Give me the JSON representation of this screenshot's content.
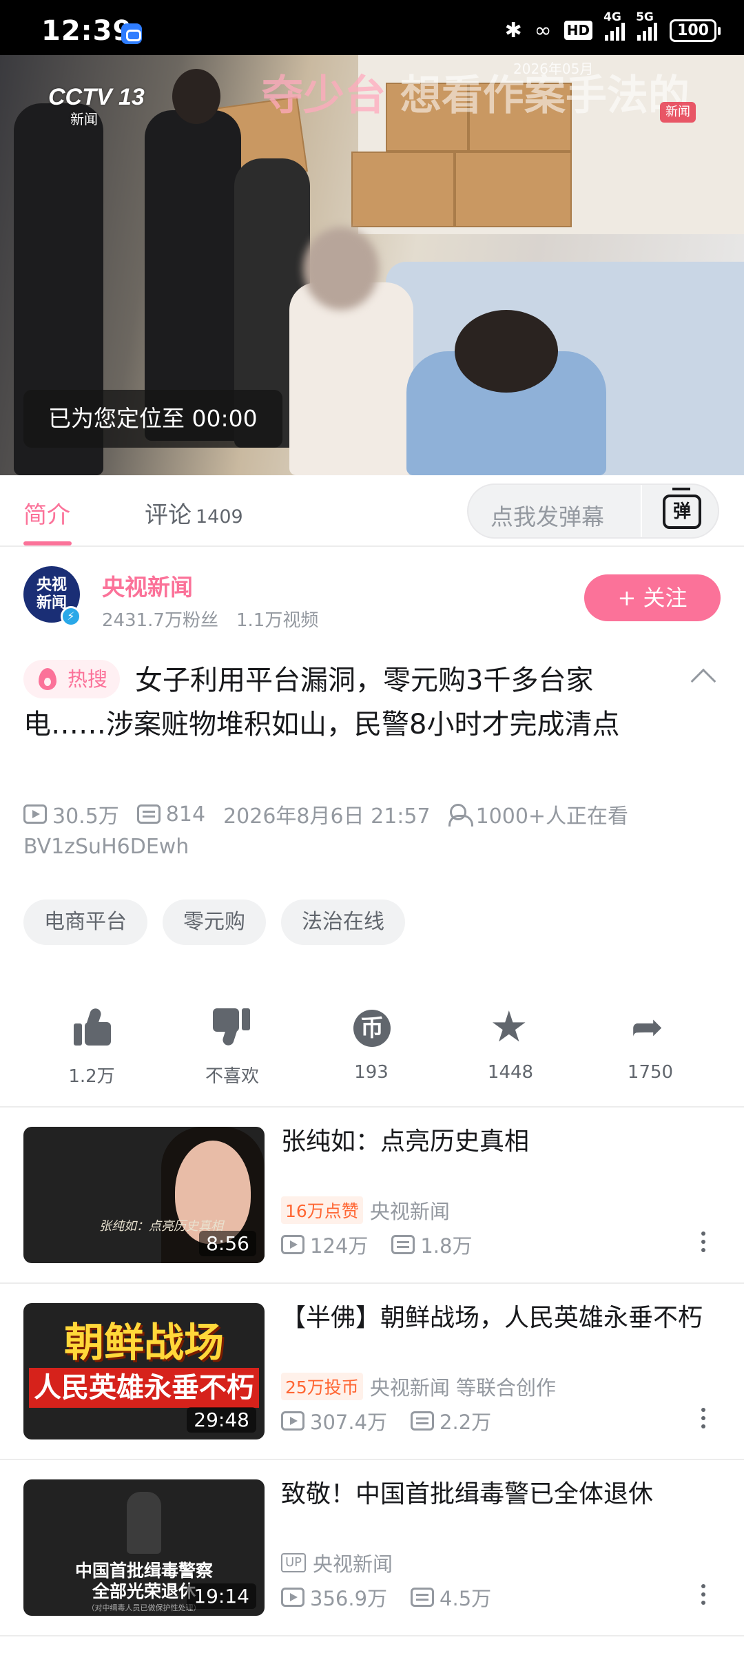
{
  "status_bar": {
    "time": "12:39",
    "network_a": "4G",
    "network_b": "5G",
    "hd": "HD",
    "battery": "100"
  },
  "video": {
    "channel_logo": "CCTV 13",
    "channel_sub": "新闻",
    "overlay_left": "夺少台",
    "overlay_right": "想看作案手法的",
    "timestamp": "2026年05月",
    "badge": "新闻",
    "toast": "已为您定位至 00:00"
  },
  "tabs": {
    "intro": "简介",
    "comments": "评论",
    "comments_count": "1409",
    "danmu_placeholder": "点我发弹幕",
    "danmu_button": "弹"
  },
  "uploader": {
    "avatar_line1": "央视",
    "avatar_line2": "新闻",
    "name": "央视新闻",
    "followers": "2431.7万粉丝",
    "videos": "1.1万视频",
    "follow_label": "+ 关注"
  },
  "video_info": {
    "hot_badge": "热搜",
    "title": "女子利用平台漏洞，零元购3千多台家电……涉案赃物堆积如山，民警8小时才完成清点",
    "views": "30.5万",
    "danmaku": "814",
    "date": "2026年8月6日 21:57",
    "watching": "1000+人正在看",
    "bvid": "BV1zSuH6DEwh",
    "tags": [
      "电商平台",
      "零元购",
      "法治在线"
    ]
  },
  "actions": {
    "like": "1.2万",
    "dislike": "不喜欢",
    "coin": "193",
    "coin_glyph": "币",
    "favorite": "1448",
    "share": "1750"
  },
  "related": [
    {
      "title": "张纯如：点亮历史真相",
      "badge": "16万点赞",
      "up": "央视新闻",
      "views": "124万",
      "danmaku": "1.8万",
      "duration": "8:56",
      "thumb_caption": "张纯如：点亮历史真相"
    },
    {
      "title": "【半佛】朝鲜战场，人民英雄永垂不朽",
      "badge": "25万投币",
      "up": "央视新闻 等联合创作",
      "views": "307.4万",
      "danmaku": "2.2万",
      "duration": "29:48",
      "thumb_line1": "朝鲜战场",
      "thumb_line2": "人民英雄永垂不朽"
    },
    {
      "title": "致敬！中国首批缉毒警已全体退休",
      "up_tag": "UP",
      "up": "央视新闻",
      "views": "356.9万",
      "danmaku": "4.5万",
      "duration": "19:14",
      "thumb_line1": "中国首批缉毒警察",
      "thumb_line2": "全部光荣退休",
      "thumb_small": "（对中缉毒人员已做保护性处理）"
    }
  ],
  "colors": {
    "accent": "#fb7299",
    "text": "#18191c",
    "muted": "#9499a0"
  }
}
